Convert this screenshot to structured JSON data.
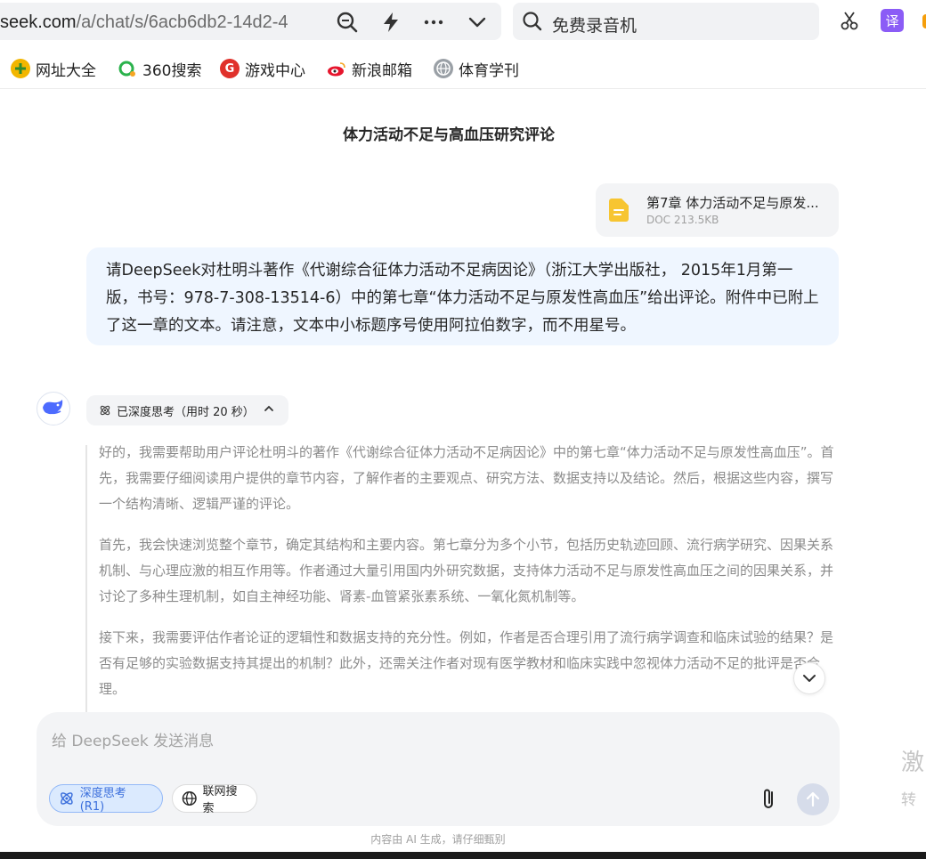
{
  "browser": {
    "url_bold": "seek.com",
    "url_rest": "/a/chat/s/6acb6db2-14d2-4",
    "search_placeholder": "免费录音机",
    "translate_badge": "译"
  },
  "bookmarks": [
    {
      "label": "网址大全"
    },
    {
      "label": "360搜索"
    },
    {
      "label": "游戏中心"
    },
    {
      "label": "新浪邮箱"
    },
    {
      "label": "体育学刊"
    }
  ],
  "chat": {
    "title": "体力活动不足与高血压研究评论",
    "file": {
      "name": "第7章 体力活动不足与原发...",
      "meta": "DOC 213.5KB"
    },
    "user_message": "请DeepSeek对杜明斗著作《代谢综合征体力活动不足病因论》（浙江大学出版社， 2015年1月第一版，书号：978-7-308-13514-6）中的第七章“体力活动不足与原发性高血压”给出评论。附件中已附上了这一章的文本。请注意，文本中小标题序号使用阿拉伯数字，而不用星号。",
    "think_label": "已深度思考（用时 20 秒）",
    "think_paragraphs": [
      "好的，我需要帮助用户评论杜明斗的著作《代谢综合征体力活动不足病因论》中的第七章“体力活动不足与原发性高血压”。首先，我需要仔细阅读用户提供的章节内容，了解作者的主要观点、研究方法、数据支持以及结论。然后，根据这些内容，撰写一个结构清晰、逻辑严谨的评论。",
      "首先，我会快速浏览整个章节，确定其结构和主要内容。第七章分为多个小节，包括历史轨迹回顾、流行病学研究、因果关系机制、与心理应激的相互作用等。作者通过大量引用国内外研究数据，支持体力活动不足与原发性高血压之间的因果关系，并讨论了多种生理机制，如自主神经功能、肾素-血管紧张素系统、一氧化氮机制等。",
      "接下来，我需要评估作者论证的逻辑性和数据支持的充分性。例如，作者是否合理引用了流行病学调查和临床试验的结果？是否有足够的实验数据支持其提出的机制？此外，还需关注作者对现有医学教材和临床实践中忽视体力活动不足的批评是否合理。"
    ]
  },
  "composer": {
    "placeholder": "给 DeepSeek 发送消息",
    "deep_think_label": "深度思考 (R1)",
    "web_search_label": "联网搜索"
  },
  "footnote": "内容由 AI 生成，请仔细甄别",
  "side_text": {
    "big": "激",
    "small": "转"
  }
}
